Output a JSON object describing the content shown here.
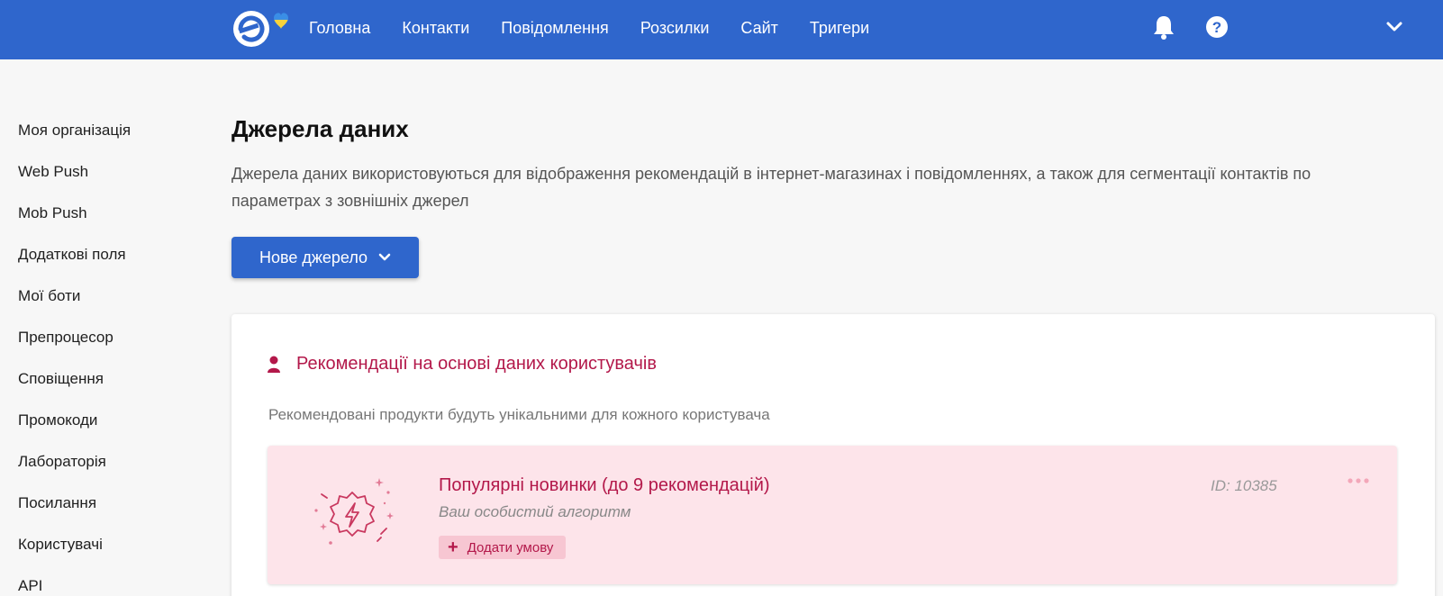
{
  "colors": {
    "topbar": "#2f66cc",
    "accent": "#b3184a",
    "rec_bg": "#fde4ea",
    "flag_blue": "#3a8ee6",
    "flag_yellow": "#f7d23b"
  },
  "header": {
    "nav": [
      "Головна",
      "Контакти",
      "Повідомлення",
      "Розсилки",
      "Сайт",
      "Тригери"
    ],
    "icons": [
      "logo-icon",
      "bell-icon",
      "help-icon",
      "chevron-down-icon"
    ]
  },
  "sidebar": {
    "items": [
      "Моя організація",
      "Web Push",
      "Mob Push",
      "Додаткові поля",
      "Мої боти",
      "Препроцесор",
      "Сповіщення",
      "Промокоди",
      "Лабораторія",
      "Посилання",
      "Користувачі",
      "API"
    ]
  },
  "main": {
    "title": "Джерела даних",
    "description": "Джерела даних використовуються для відображення рекомендацій в інтернет-магазинах і повідомленнях, а також для сегментації контактів по параметрах з зовнішніх джерел",
    "new_source_label": "Нове джерело",
    "section": {
      "icon": "user-icon",
      "title": "Рекомендації на основі даних користувачів",
      "subtitle": "Рекомендовані продукти будуть унікальними для кожного користувача",
      "recommendation": {
        "icon": "lightning-badge-icon",
        "title": "Популярні новинки (до 9 рекомендацій)",
        "description": "Ваш особистий алгоритм",
        "add_condition_label": "Додати умову",
        "id_label": "ID: 10385",
        "menu_icon": "more-dots-icon"
      }
    }
  }
}
